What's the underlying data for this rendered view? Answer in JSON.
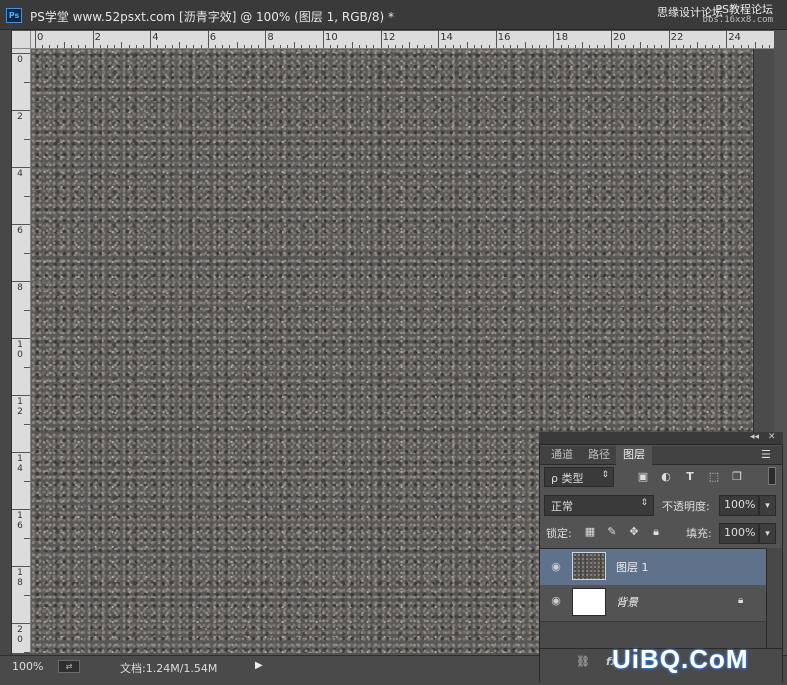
{
  "window": {
    "app_icon": "Ps",
    "title": "PS学堂 www.52psxt.com [沥青字效] @ 100% (图层 1, RGB/8) *",
    "watermark_left": "思缘设计论坛",
    "watermark_right": "PS教程论坛",
    "watermark_url": "bbs.16xx8.com"
  },
  "rulers": {
    "horizontal": [
      "0",
      "2",
      "4",
      "6",
      "8",
      "10",
      "12",
      "14",
      "16",
      "18",
      "20",
      "22",
      "24"
    ],
    "vertical": [
      "0",
      "2",
      "4",
      "6",
      "8",
      "10",
      "12",
      "14",
      "16",
      "18",
      "20"
    ]
  },
  "status": {
    "zoom": "100%",
    "doc_info": "文档:1.24M/1.54M",
    "arrow": "▶"
  },
  "layers_panel": {
    "tabs": [
      {
        "label": "通道",
        "active": false
      },
      {
        "label": "路径",
        "active": false
      },
      {
        "label": "图层",
        "active": true
      }
    ],
    "filter_type": "ρ 类型",
    "blend_mode": "正常",
    "opacity_label": "不透明度:",
    "opacity_value": "100%",
    "lock_label": "锁定:",
    "fill_label": "填充:",
    "fill_value": "100%",
    "layers": [
      {
        "name": "图层 1",
        "selected": true,
        "visible": true
      },
      {
        "name": "背景",
        "selected": false,
        "visible": true,
        "locked": true
      }
    ],
    "footer_fx": "fx"
  },
  "brand_watermark": "UiBQ.CoM",
  "colors": {
    "selected_layer": "#5f718b",
    "panel_bg": "#535353",
    "titlebar": "#3a3a3a"
  }
}
